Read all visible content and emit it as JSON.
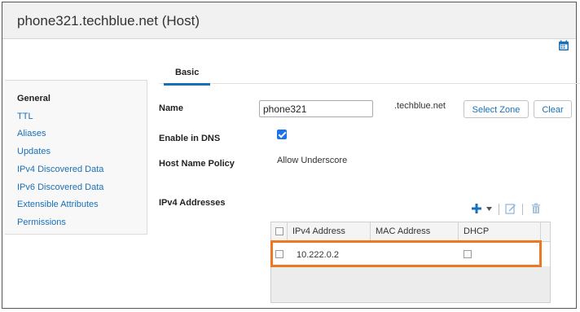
{
  "window": {
    "title": "phone321.techblue.net (Host)"
  },
  "tabs": [
    {
      "label": "Basic"
    }
  ],
  "sidebar": {
    "items": [
      {
        "label": "General"
      },
      {
        "label": "TTL"
      },
      {
        "label": "Aliases"
      },
      {
        "label": "Updates"
      },
      {
        "label": "IPv4 Discovered Data"
      },
      {
        "label": "IPv6 Discovered Data"
      },
      {
        "label": "Extensible Attributes"
      },
      {
        "label": "Permissions"
      }
    ]
  },
  "form": {
    "name_label": "Name",
    "name_value": "phone321",
    "domain_suffix": ".techblue.net",
    "select_zone_button": "Select Zone",
    "clear_button": "Clear",
    "enable_dns_label": "Enable in DNS",
    "enable_dns_checked": true,
    "policy_label": "Host Name Policy",
    "policy_value": "Allow Underscore",
    "ipv4_label": "IPv4 Addresses"
  },
  "ipv4_table": {
    "columns": [
      "IPv4 Address",
      "MAC Address",
      "DHCP"
    ],
    "rows": [
      {
        "ipv4": "10.222.0.2",
        "mac": "",
        "dhcp": false
      }
    ]
  },
  "colors": {
    "accent": "#1a70b8",
    "highlight": "#ee7722",
    "checkbox": "#1a73e8"
  },
  "icons": [
    "calendar-icon",
    "add-icon",
    "dropdown-caret-icon",
    "edit-icon",
    "delete-icon"
  ]
}
